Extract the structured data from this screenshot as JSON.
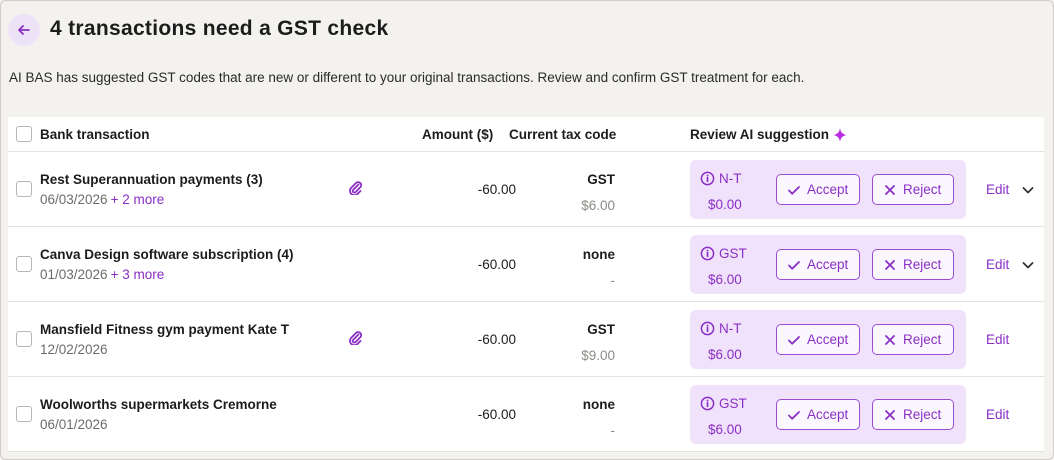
{
  "header": {
    "title": "4 transactions need a GST check",
    "subtitle": "AI BAS has suggested GST codes that are new or different to your original transactions. Review and confirm GST treatment for each."
  },
  "table": {
    "columns": {
      "bank_transaction": "Bank transaction",
      "amount": "Amount ($)",
      "current_tax_code": "Current tax code",
      "review_ai": "Review AI suggestion"
    },
    "rows": [
      {
        "name": "Rest Superannuation payments (3)",
        "date": "06/03/2026",
        "more": "+ 2 more",
        "attachment": true,
        "amount": "-60.00",
        "current_code": "GST",
        "current_tax": "$6.00",
        "ai_code": "N-T",
        "ai_amount": "$0.00",
        "accept": "Accept",
        "reject": "Reject",
        "edit": "Edit",
        "expandable": true
      },
      {
        "name": "Canva Design software subscription (4)",
        "date": "01/03/2026",
        "more": "+ 3 more",
        "attachment": false,
        "amount": "-60.00",
        "current_code": "none",
        "current_tax": "-",
        "ai_code": "GST",
        "ai_amount": "$6.00",
        "accept": "Accept",
        "reject": "Reject",
        "edit": "Edit",
        "expandable": true
      },
      {
        "name": "Mansfield Fitness gym payment Kate T",
        "date": "12/02/2026",
        "more": "",
        "attachment": true,
        "amount": "-60.00",
        "current_code": "GST",
        "current_tax": "$9.00",
        "ai_code": "N-T",
        "ai_amount": "$6.00",
        "accept": "Accept",
        "reject": "Reject",
        "edit": "Edit",
        "expandable": false
      },
      {
        "name": "Woolworths supermarkets Cremorne",
        "date": "06/01/2026",
        "more": "",
        "attachment": false,
        "amount": "-60.00",
        "current_code": "none",
        "current_tax": "-",
        "ai_code": "GST",
        "ai_amount": "$6.00",
        "accept": "Accept",
        "reject": "Reject",
        "edit": "Edit",
        "expandable": false
      }
    ]
  },
  "icons": {
    "back": "arrow-left-icon",
    "sparkle": "sparkle-icon",
    "attachment": "paperclip-icon",
    "info": "info-circle-icon",
    "accept": "check-icon",
    "reject": "x-icon",
    "expand": "chevron-down-icon"
  },
  "colors": {
    "accent": "#8a2fc5",
    "ai_box_bg": "#f1e2fb",
    "back_btn_bg": "#ede3f7"
  }
}
